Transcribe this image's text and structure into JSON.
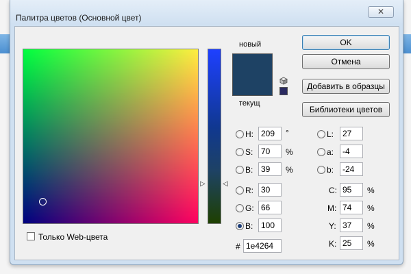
{
  "window": {
    "title": "Палитра цветов (Основной цвет)",
    "close_glyph": "✕"
  },
  "preview": {
    "new_label": "новый",
    "current_label": "текущ",
    "new_color": "#1e4264",
    "current_color": "#1e4264"
  },
  "buttons": {
    "ok": "OK",
    "cancel": "Отмена",
    "add_to_swatches": "Добавить в образцы",
    "color_libraries": "Библиотеки цветов"
  },
  "hsb": {
    "h": {
      "label": "H:",
      "value": "209",
      "unit": "°"
    },
    "s": {
      "label": "S:",
      "value": "70",
      "unit": "%"
    },
    "b": {
      "label": "B:",
      "value": "39",
      "unit": "%"
    }
  },
  "rgb": {
    "r": {
      "label": "R:",
      "value": "30"
    },
    "g": {
      "label": "G:",
      "value": "66"
    },
    "b": {
      "label": "B:",
      "value": "100"
    }
  },
  "lab": {
    "l": {
      "label": "L:",
      "value": "27"
    },
    "a": {
      "label": "a:",
      "value": "-4"
    },
    "b": {
      "label": "b:",
      "value": "-24"
    }
  },
  "cmyk": {
    "c": {
      "label": "C:",
      "value": "95",
      "unit": "%"
    },
    "m": {
      "label": "M:",
      "value": "74",
      "unit": "%"
    },
    "y": {
      "label": "Y:",
      "value": "37",
      "unit": "%"
    },
    "k": {
      "label": "K:",
      "value": "25",
      "unit": "%"
    }
  },
  "hex": {
    "label": "#",
    "value": "1e4264"
  },
  "web_only": {
    "label": "Только Web-цвета",
    "checked": false
  },
  "selected_channel": "rgb.b",
  "icons": {
    "cube": "gamut-cube-icon",
    "web_swatch": "web-safe-swatch-icon"
  }
}
